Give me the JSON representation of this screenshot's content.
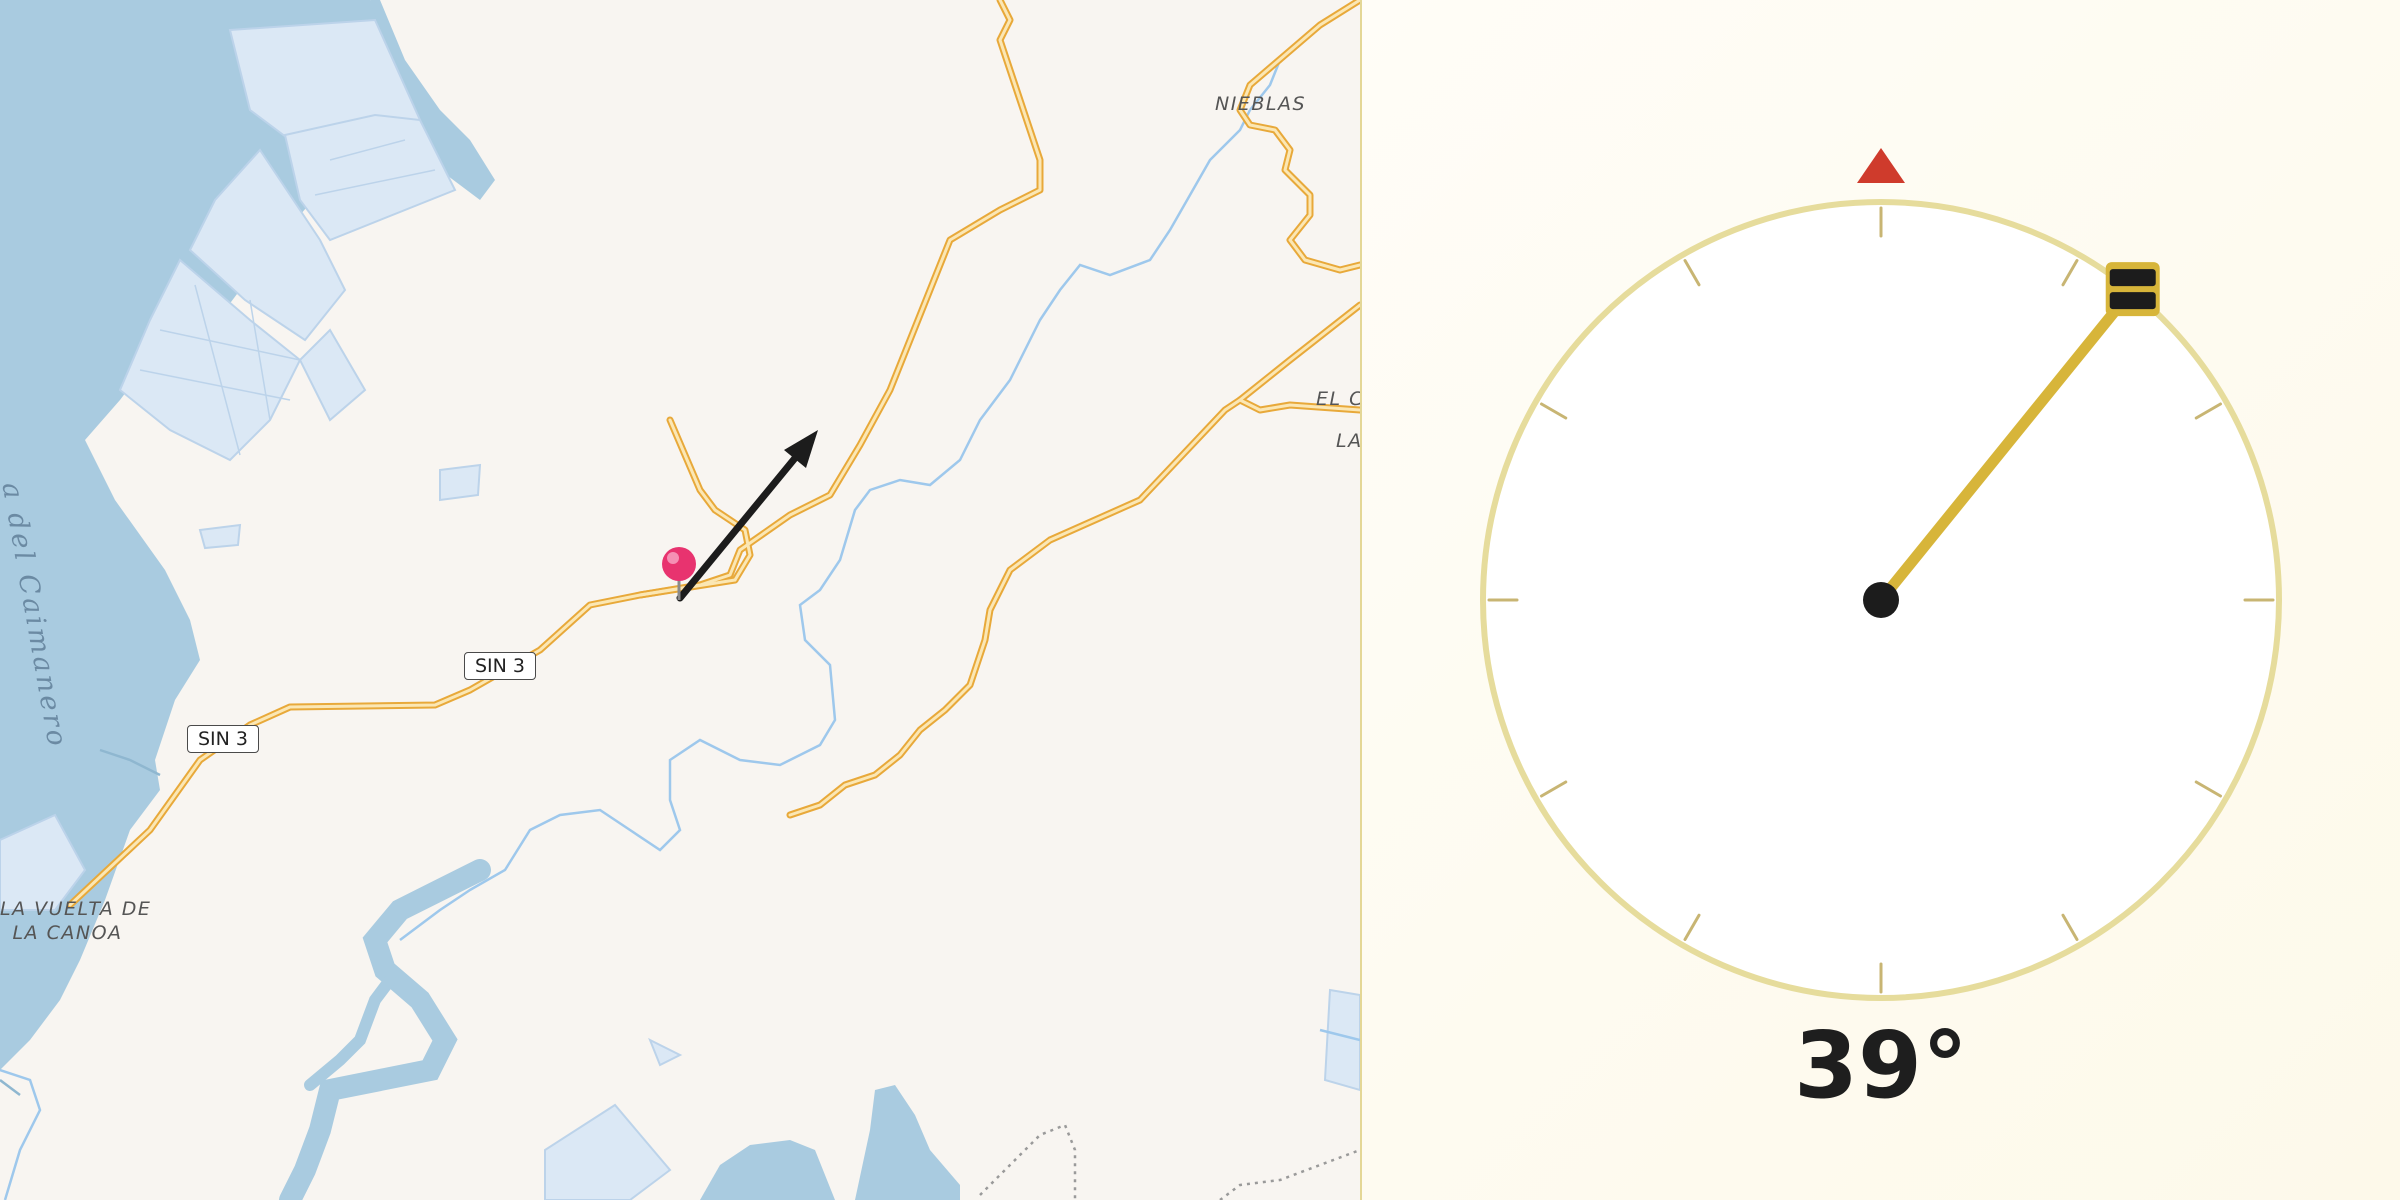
{
  "map": {
    "labels": {
      "nieblas": "NIEBLAS",
      "el_c": "EL C",
      "la": "LA",
      "la_vuelta_line1": "LA VUELTA DE",
      "la_vuelta_line2": "LA CANOA",
      "water_body": "a del Caimanero"
    },
    "road_shields": [
      "SIN 3",
      "SIN 3"
    ],
    "marker": {
      "icon": "map-pin-icon",
      "color": "#e8336f"
    },
    "direction_arrow": {
      "icon": "direction-arrow-icon",
      "color": "#1c1c1c"
    },
    "colors": {
      "land": "#f8f5f1",
      "water": "#a9cbe0",
      "river": "#9ec8ec",
      "road": "#f0b33a",
      "salt_ponds": "#dbe8f5"
    }
  },
  "compass": {
    "heading_deg": 39,
    "heading_label": "39°",
    "north_marker_color": "#cf3b2c",
    "ring_color": "#e6dc9c",
    "needle_color": "#d7b53a"
  }
}
